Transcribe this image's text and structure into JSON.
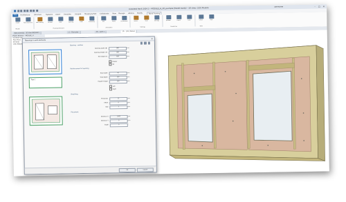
{
  "window": {
    "title": "Autodesk Revit 2024.3 – MODULE_H_3D_example [Model-ready] – 3D view: {3D} Module",
    "user": "username",
    "controls": [
      "–",
      "□",
      "✕"
    ]
  },
  "menu": {
    "tabs": [
      "File",
      "Architecture",
      "Structure",
      "Systems",
      "Insert",
      "Annotate",
      "Analyze",
      "Massing & Site",
      "Collaborate",
      "View",
      "Manage",
      "Add-Ins",
      "Modify",
      "Wood Framing"
    ],
    "active_tab": "Wood Framing"
  },
  "ribbon": {
    "buttons": [
      {
        "label": "Frame",
        "icon": "frame-icon"
      },
      {
        "label": "Panel elements",
        "icon": "panel-icon"
      },
      {
        "label": "Wall framing",
        "icon": "wall-frame-icon"
      },
      {
        "label": "Window",
        "icon": "window-icon"
      },
      {
        "label": "Door",
        "icon": "door-icon"
      },
      {
        "label": "Opening",
        "icon": "opening-icon"
      },
      {
        "label": "Plate",
        "icon": "plate-icon"
      },
      {
        "label": "Sheathing",
        "icon": "sheathing-icon"
      },
      {
        "label": "Text",
        "icon": "text-icon"
      },
      {
        "label": "Marks",
        "icon": "marks-icon"
      },
      {
        "label": "Dimensions",
        "icon": "dimension-icon"
      },
      {
        "label": "Batten",
        "icon": "batten-icon"
      },
      {
        "label": "Stud",
        "icon": "stud-icon"
      },
      {
        "label": "Settings",
        "icon": "settings-icon"
      },
      {
        "label": "Number",
        "icon": "number-icon"
      },
      {
        "label": "Export",
        "icon": "export-icon"
      },
      {
        "label": "Lists",
        "icon": "lists-icon"
      },
      {
        "label": "Check",
        "icon": "check-icon"
      },
      {
        "label": "Help",
        "icon": "help-icon"
      }
    ],
    "groups": [
      "Modify",
      "Framing elements",
      "Annotation",
      "Settings",
      "Production",
      "Tools"
    ]
  },
  "doc_tabs": [
    "Wall Assembly – 3D View (MODULE)",
    "L1 – Floor plan",
    "3D – Level 1",
    "3D – {3D} Module"
  ],
  "browser": {
    "title": "Project Browser – MODULE_H",
    "items": [
      "[0] Views (all)",
      "  Floor Plans",
      "  3D Views",
      "    {3D} Module"
    ]
  },
  "dialog": {
    "title": "Openings in wall elements",
    "thumbnail_labels": [
      "Type 1",
      "Type 2",
      "Type 3"
    ],
    "section_1": "Opening – window",
    "fields_1": [
      {
        "label": "Opening width (B)",
        "value": "900",
        "unit": "mm"
      },
      {
        "label": "Opening height (H)",
        "value": "900",
        "unit": "mm"
      },
      {
        "label": "Sill height (h)",
        "value": "800",
        "unit": "mm"
      }
    ],
    "checks_1": [
      "Header",
      "Sill"
    ],
    "section_2": "Reinforcement of opening",
    "fields_2": [
      {
        "label": "Stud width",
        "value": "45",
        "unit": "mm"
      },
      {
        "label": "Stud depth",
        "value": "145",
        "unit": "mm"
      },
      {
        "label": "Header height",
        "value": "195",
        "unit": "mm"
      }
    ],
    "checks_2": [
      "Left",
      "Right"
    ],
    "section_3": "Sheathing",
    "fields_3": [
      {
        "label": "Thickness",
        "value": "12",
        "unit": "mm"
      },
      {
        "label": "Offset",
        "value": "0",
        "unit": "mm"
      },
      {
        "label": "Gap",
        "value": "2",
        "unit": "mm"
      }
    ],
    "section_4": "Placement",
    "fields_4": [
      {
        "label": "Distance X",
        "value": "1000",
        "unit": "mm"
      },
      {
        "label": "Distance Y",
        "value": "0",
        "unit": "mm"
      },
      {
        "label": "Angle",
        "value": "0",
        "unit": "°"
      }
    ],
    "buttons": [
      "OK",
      "Cancel"
    ]
  },
  "colors": {
    "frame_wood": "#d8cf9c",
    "sheathing": "#d9b7a0",
    "glass": "#e8eef2",
    "accent_blue": "#2b6cb0",
    "thumb_green": "#4aa066"
  }
}
